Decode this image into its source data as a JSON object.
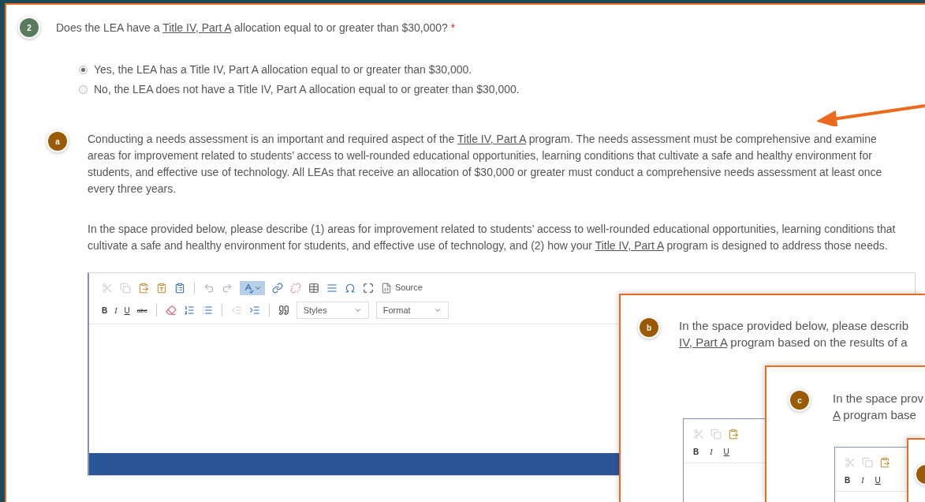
{
  "question": {
    "number": "2",
    "parts": [
      {
        "kind": "text",
        "text": "Does the LEA have a "
      },
      {
        "kind": "link",
        "text": "Title IV, Part A"
      },
      {
        "kind": "text",
        "text": " allocation equal to or greater than $30,000?"
      }
    ],
    "required_mark": "*",
    "options": [
      {
        "label": "Yes, the LEA has a Title IV, Part A allocation equal to or greater than $30,000.",
        "selected": true
      },
      {
        "label": "No, the LEA does not have a Title IV, Part A allocation equal to or greater than $30,000.",
        "selected": false
      }
    ]
  },
  "section_a": {
    "badge": "a",
    "paragraphs": [
      [
        {
          "kind": "text",
          "text": "Conducting a needs assessment is an important and required aspect of the "
        },
        {
          "kind": "link",
          "text": "Title IV, Part A"
        },
        {
          "kind": "text",
          "text": " program. The needs assessment must be comprehensive and examine areas for improvement related to students’ access to well-rounded educational opportunities, learning conditions that cultivate a safe and healthy environment for students, and effective use of technology. All LEAs that receive an allocation of $30,000 or greater must conduct a comprehensive needs assessment at least once every three years."
        }
      ],
      [
        {
          "kind": "text",
          "text": "In the space provided below, please describe (1) areas for improvement related to students’ access to well-rounded educational opportunities, learning conditions that cultivate a safe and healthy environment for students, and effective use of technology, and (2) how your "
        },
        {
          "kind": "link",
          "text": "Title IV, Part A"
        },
        {
          "kind": "text",
          "text": " program is designed to address those needs."
        }
      ]
    ],
    "editor": {
      "spellcheck_on": true,
      "source_label": "Source",
      "format_buttons": [
        "B",
        "I",
        "U",
        "abc"
      ],
      "styles": "Styles",
      "format": "Format"
    }
  },
  "overlays": [
    {
      "kind": "card",
      "badge": "b",
      "lines": [
        [
          {
            "kind": "text",
            "text": "In the space provided below, please describ"
          }
        ],
        [
          {
            "kind": "link",
            "text": "IV, Part A"
          },
          {
            "kind": "text",
            "text": " program based on the results of a"
          }
        ]
      ],
      "editor": {
        "format_buttons": [
          "B",
          "I",
          "U"
        ]
      }
    },
    {
      "kind": "card",
      "badge": "c",
      "lines": [
        [
          {
            "kind": "text",
            "text": "In the space prov"
          }
        ],
        [
          {
            "kind": "link",
            "text": "A"
          },
          {
            "kind": "text",
            "text": " program base"
          }
        ]
      ],
      "editor": {
        "format_buttons": [
          "B",
          "I",
          "U"
        ]
      }
    },
    {
      "kind": "card"
    }
  ]
}
